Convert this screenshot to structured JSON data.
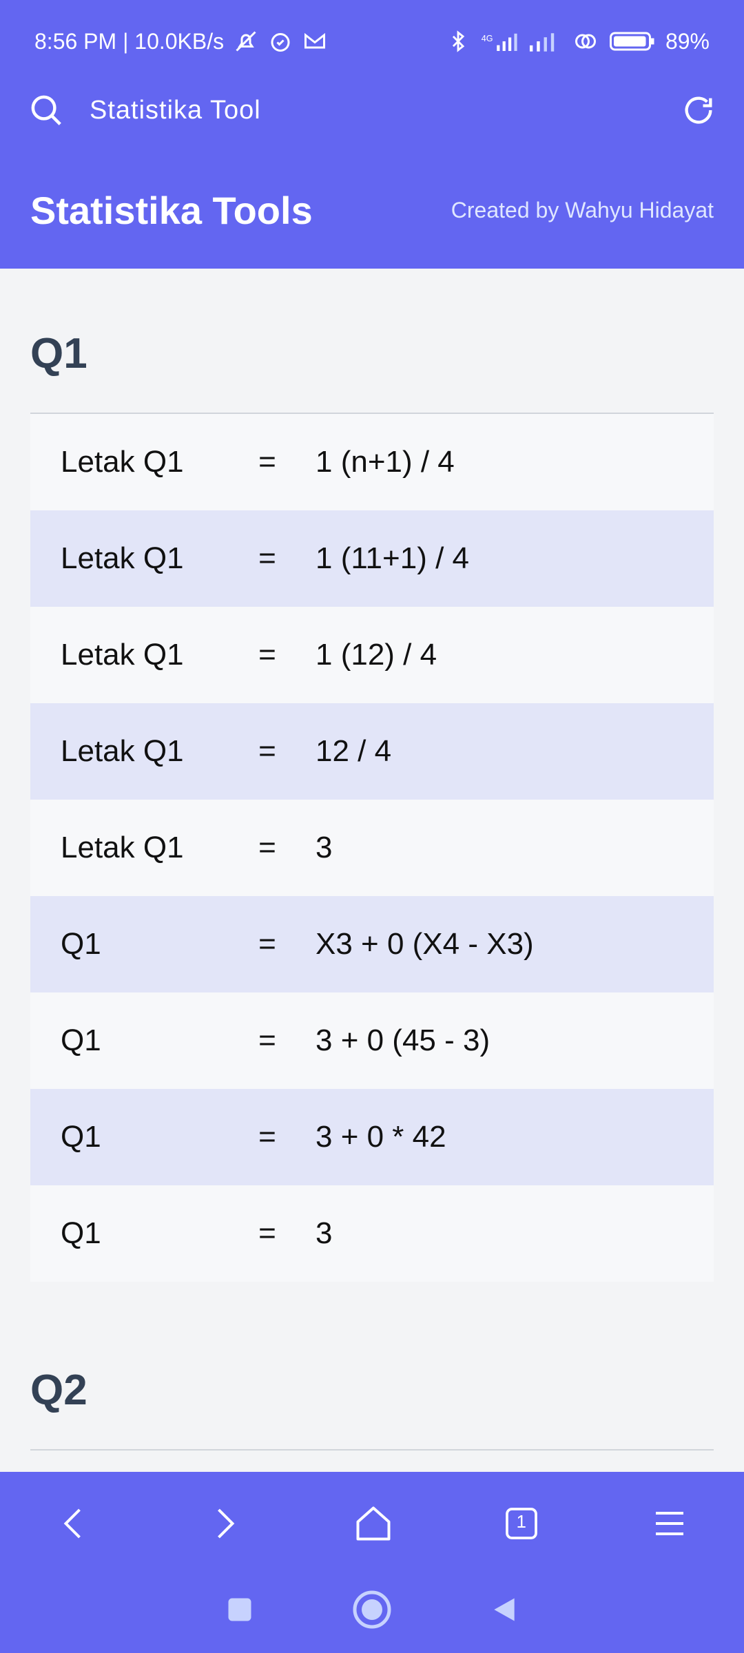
{
  "status_bar": {
    "time_info": "8:56 PM | 10.0KB/s",
    "battery": "89%",
    "icons": [
      "mute-icon",
      "alarm-icon",
      "gmail-icon",
      "bluetooth-icon",
      "signal-4g-icon",
      "signal-icon",
      "hotspot-icon",
      "battery-icon"
    ]
  },
  "browser": {
    "page_title": "Statistika Tool",
    "icons": {
      "search": "search-icon",
      "reload": "reload-icon"
    }
  },
  "site_header": {
    "title": "Statistika Tools",
    "credit": "Created by Wahyu Hidayat"
  },
  "sections": {
    "q1": {
      "title": "Q1",
      "rows": [
        {
          "label": "Letak Q1",
          "op": "=",
          "value": "1 (n+1) / 4"
        },
        {
          "label": "Letak Q1",
          "op": "=",
          "value": "1 (11+1) / 4"
        },
        {
          "label": "Letak Q1",
          "op": "=",
          "value": "1 (12) / 4"
        },
        {
          "label": "Letak Q1",
          "op": "=",
          "value": "12 / 4"
        },
        {
          "label": "Letak Q1",
          "op": "=",
          "value": "3"
        },
        {
          "label": "Q1",
          "op": "=",
          "value": "X3 + 0 (X4 - X3)"
        },
        {
          "label": "Q1",
          "op": "=",
          "value": "3 + 0 (45 - 3)"
        },
        {
          "label": "Q1",
          "op": "=",
          "value": "3 + 0 * 42"
        },
        {
          "label": "Q1",
          "op": "=",
          "value": "3"
        }
      ]
    },
    "q2": {
      "title": "Q2"
    }
  },
  "bottom_nav": {
    "tab_count": "1",
    "icons": [
      "back-icon",
      "forward-icon",
      "home-icon",
      "tabs-icon",
      "menu-icon"
    ]
  },
  "system_nav": {
    "icons": [
      "recents-icon",
      "home-circle-icon",
      "back-triangle-icon"
    ]
  },
  "colors": {
    "primary": "#6366f1",
    "row_alt": "#e2e5f8",
    "row": "#f7f8fa",
    "heading": "#334155"
  }
}
